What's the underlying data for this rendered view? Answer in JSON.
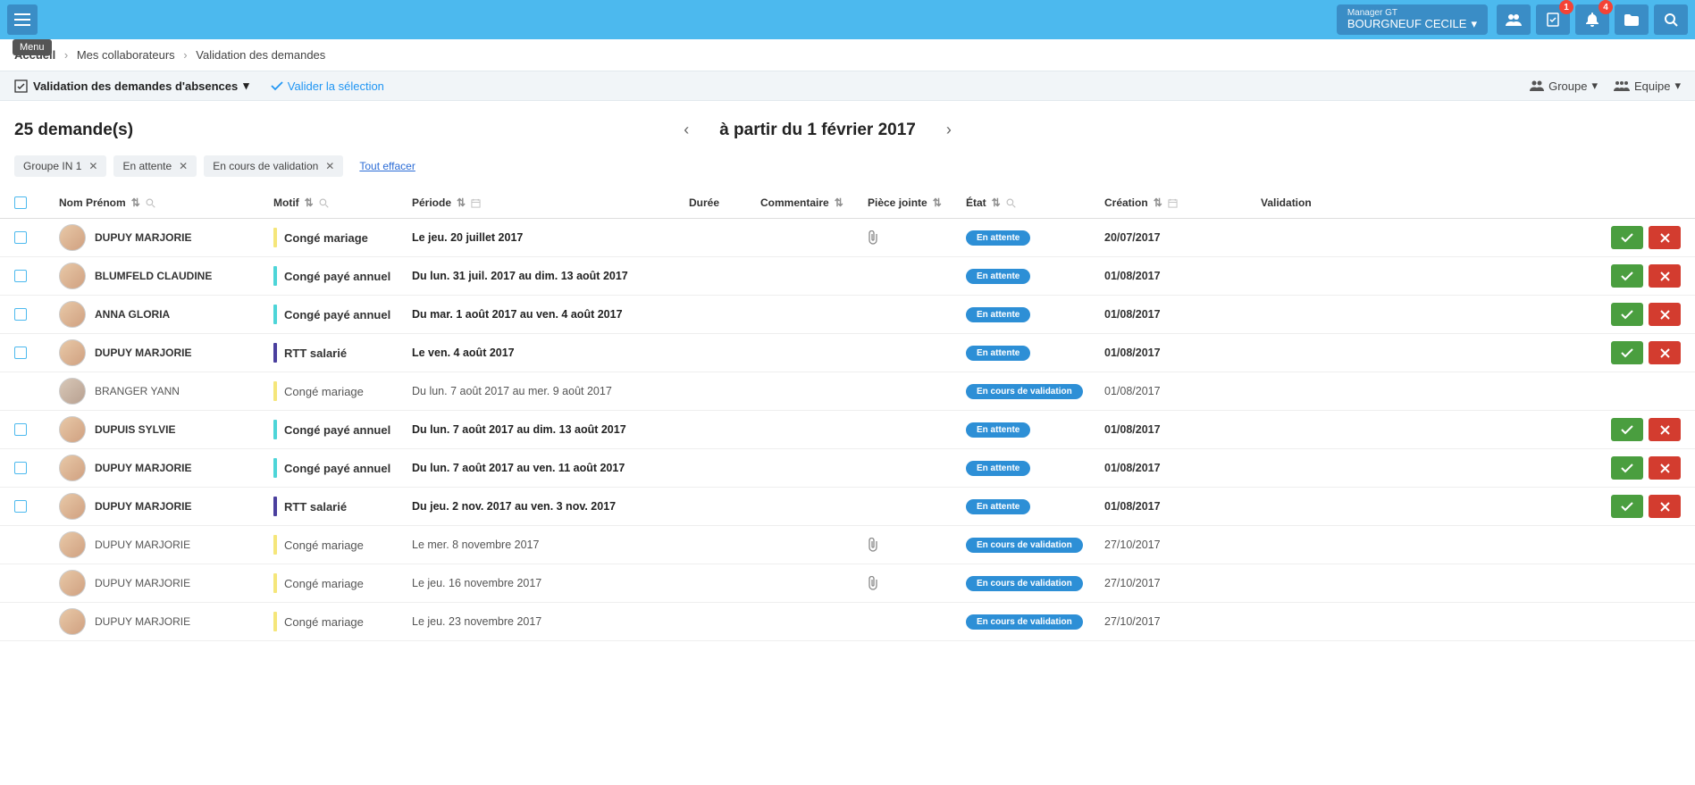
{
  "topbar": {
    "tooltip": "Menu",
    "user_role": "Manager GT",
    "user_name": "BOURGNEUF CECILE",
    "badge_alerts": "1",
    "badge_bell": "4"
  },
  "breadcrumb": {
    "items": [
      "Accueil",
      "Mes collaborateurs",
      "Validation des demandes"
    ]
  },
  "actionbar": {
    "main": "Validation des demandes d'absences",
    "validate": "Valider la sélection",
    "group": "Groupe",
    "team": "Equipe"
  },
  "header": {
    "count": "25 demande(s)",
    "date_range": "à partir du 1 février 2017"
  },
  "chips": {
    "items": [
      "Groupe IN 1",
      "En attente",
      "En cours de validation"
    ],
    "clear": "Tout effacer"
  },
  "columns": {
    "name": "Nom Prénom",
    "motif": "Motif",
    "period": "Période",
    "duration": "Durée",
    "comment": "Commentaire",
    "attachment": "Pièce jointe",
    "state": "État",
    "creation": "Création",
    "validation": "Validation"
  },
  "status": {
    "pending": "En attente",
    "in_progress": "En cours de validation"
  },
  "rows": [
    {
      "name": "DUPUY MARJORIE",
      "motif": "Congé mariage",
      "barColor": "bar-yellow",
      "period": "Le jeu. 20 juillet 2017",
      "attachment": true,
      "status": "pending",
      "creation": "20/07/2017",
      "actions": true,
      "avatar": "f"
    },
    {
      "name": "BLUMFELD CLAUDINE",
      "motif": "Congé payé annuel",
      "barColor": "bar-cyan",
      "period": "Du lun. 31 juil. 2017 au dim. 13 août 2017",
      "attachment": false,
      "status": "pending",
      "creation": "01/08/2017",
      "actions": true,
      "avatar": "f"
    },
    {
      "name": "ANNA GLORIA",
      "motif": "Congé payé annuel",
      "barColor": "bar-cyan",
      "period": "Du mar. 1 août 2017 au ven. 4 août 2017",
      "attachment": false,
      "status": "pending",
      "creation": "01/08/2017",
      "actions": true,
      "avatar": "f"
    },
    {
      "name": "DUPUY MARJORIE",
      "motif": "RTT salarié",
      "barColor": "bar-purple",
      "period": "Le ven. 4 août 2017",
      "attachment": false,
      "status": "pending",
      "creation": "01/08/2017",
      "actions": true,
      "avatar": "f"
    },
    {
      "name": "BRANGER YANN",
      "motif": "Congé mariage",
      "barColor": "bar-yellow",
      "period": "Du lun. 7 août 2017 au mer. 9 août 2017",
      "attachment": false,
      "status": "in_progress",
      "creation": "01/08/2017",
      "actions": false,
      "avatar": "m"
    },
    {
      "name": "DUPUIS SYLVIE",
      "motif": "Congé payé annuel",
      "barColor": "bar-cyan",
      "period": "Du lun. 7 août 2017 au dim. 13 août 2017",
      "attachment": false,
      "status": "pending",
      "creation": "01/08/2017",
      "actions": true,
      "avatar": "f"
    },
    {
      "name": "DUPUY MARJORIE",
      "motif": "Congé payé annuel",
      "barColor": "bar-cyan",
      "period": "Du lun. 7 août 2017 au ven. 11 août 2017",
      "attachment": false,
      "status": "pending",
      "creation": "01/08/2017",
      "actions": true,
      "avatar": "f"
    },
    {
      "name": "DUPUY MARJORIE",
      "motif": "RTT salarié",
      "barColor": "bar-purple",
      "period": "Du jeu. 2 nov. 2017 au ven. 3 nov. 2017",
      "attachment": false,
      "status": "pending",
      "creation": "01/08/2017",
      "actions": true,
      "avatar": "f"
    },
    {
      "name": "DUPUY MARJORIE",
      "motif": "Congé mariage",
      "barColor": "bar-yellow",
      "period": "Le mer. 8 novembre 2017",
      "attachment": true,
      "status": "in_progress",
      "creation": "27/10/2017",
      "actions": false,
      "avatar": "f"
    },
    {
      "name": "DUPUY MARJORIE",
      "motif": "Congé mariage",
      "barColor": "bar-yellow",
      "period": "Le jeu. 16 novembre 2017",
      "attachment": true,
      "status": "in_progress",
      "creation": "27/10/2017",
      "actions": false,
      "avatar": "f"
    },
    {
      "name": "DUPUY MARJORIE",
      "motif": "Congé mariage",
      "barColor": "bar-yellow",
      "period": "Le jeu. 23 novembre 2017",
      "attachment": false,
      "status": "in_progress",
      "creation": "27/10/2017",
      "actions": false,
      "avatar": "f"
    }
  ]
}
